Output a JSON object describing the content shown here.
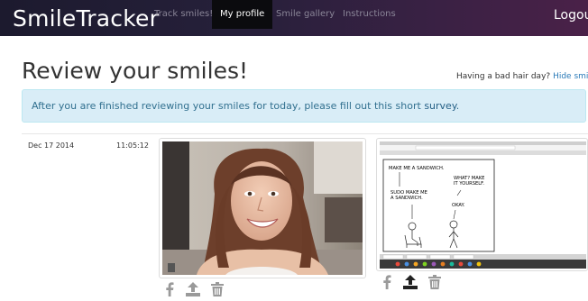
{
  "navbar": {
    "brand": "SmileTracker",
    "items": [
      {
        "label": "Track smiles!",
        "active": false
      },
      {
        "label": "My profile",
        "active": true
      },
      {
        "label": "Smile gallery",
        "active": false
      },
      {
        "label": "Instructions",
        "active": false
      }
    ],
    "logout": "Logout"
  },
  "page": {
    "title": "Review your smiles!",
    "hair_prompt": "Having a bad hair day?",
    "hair_link": "Hide smiles",
    "alert_text": "After you are finished reviewing your smiles for today, please fill out this short",
    "alert_link": "survey",
    "alert_end": "."
  },
  "entry": {
    "date": "Dec 17 2014",
    "time": "11:05:12",
    "comic": {
      "speech1": "MAKE ME A SANDWICH.",
      "speech2": "WHAT? MAKE IT YOURSELF.",
      "speech3": "SUDO MAKE ME A SANDWICH.",
      "speech4": "OKAY."
    },
    "actions": [
      "facebook-icon",
      "upload-icon",
      "trash-icon"
    ]
  },
  "colors": {
    "navbar_start": "#1c1a2e",
    "navbar_end": "#4a2148",
    "alert_bg": "#d9edf7",
    "alert_text": "#31708f",
    "link": "#2a7ab8"
  }
}
